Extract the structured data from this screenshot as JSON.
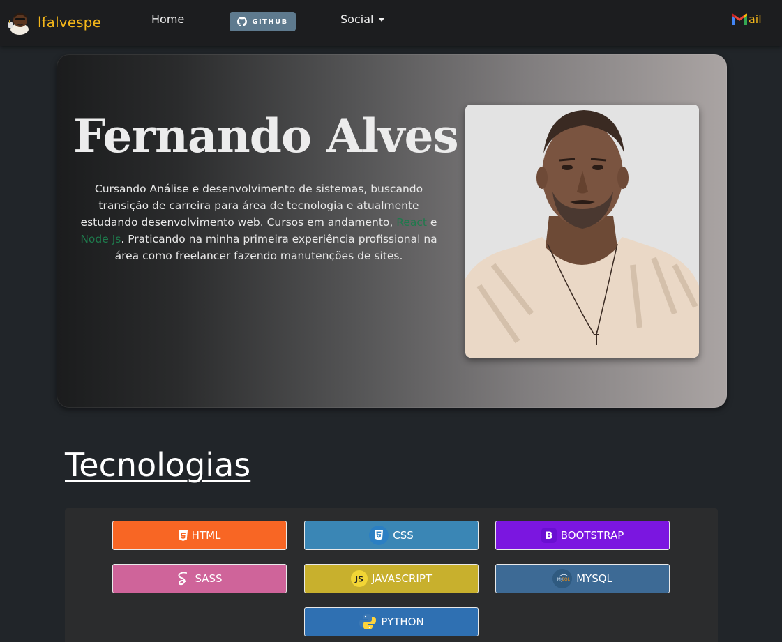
{
  "nav": {
    "brand": "lfalvespe",
    "home": "Home",
    "github": "GITHUB",
    "social": "Social",
    "mail_suffix": "ail"
  },
  "hero": {
    "name": "Fernando Alves",
    "bio_1": "Cursando Análise e desenvolvimento de sistemas, buscando transição de carreira para área de tecnologia e atualmente estudando desenvolvimento web. Cursos em andamento, ",
    "bio_react": "React",
    "bio_e": " e ",
    "bio_node": "Node Js",
    "bio_2": ". Praticando na minha primeira experiência profissional na área como freelancer fazendo manutenções de sites."
  },
  "tech": {
    "title": "Tecnologias",
    "items": [
      {
        "label": "HTML",
        "color": "#f86624",
        "icon": "html5-icon"
      },
      {
        "label": "CSS",
        "color": "#3a86b5",
        "icon": "css3-icon"
      },
      {
        "label": "BOOTSTRAP",
        "color": "#7b16e0",
        "icon": "bootstrap-icon"
      },
      {
        "label": "SASS",
        "color": "#cf649a",
        "icon": "sass-icon"
      },
      {
        "label": "JAVASCRIPT",
        "color": "#c8b02d",
        "icon": "javascript-icon"
      },
      {
        "label": "MYSQL",
        "color": "#3d6a95",
        "icon": "mysql-icon"
      },
      {
        "label": "PYTHON",
        "color": "#2f70b2",
        "icon": "python-icon"
      }
    ]
  },
  "colors": {
    "background": "#212529",
    "navbar": "#1c1d1f",
    "brand": "#f3b61a",
    "github_badge": "#5e7a8e",
    "highlight": "#1e7a4c"
  }
}
